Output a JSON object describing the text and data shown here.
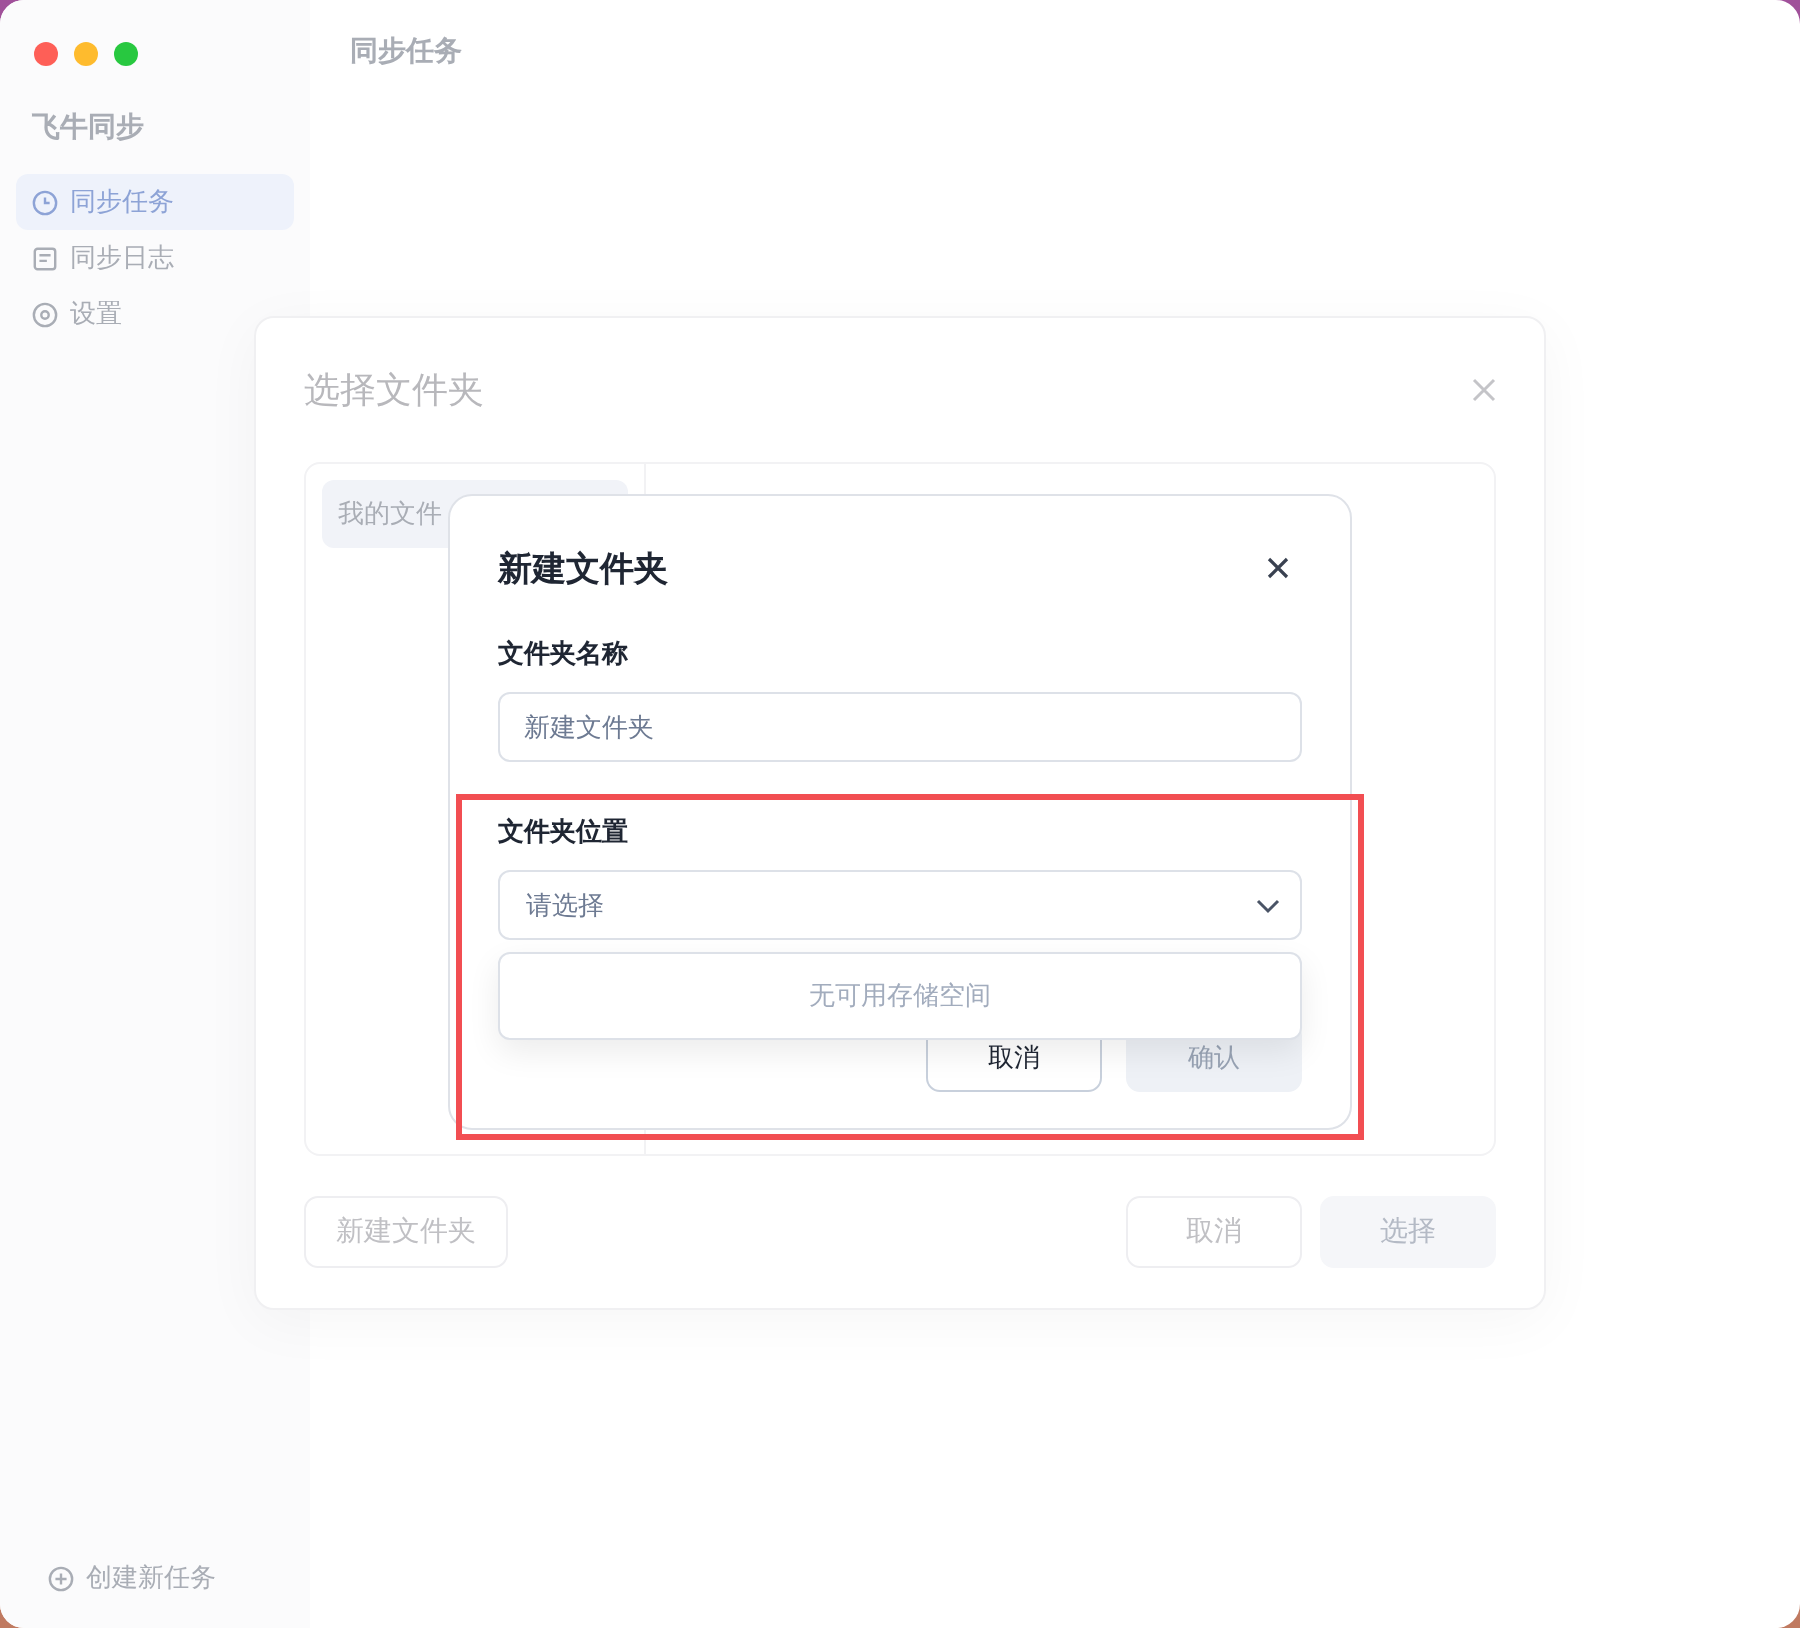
{
  "app": {
    "sidebar": {
      "title": "飞牛同步",
      "items": [
        {
          "label": "同步任务",
          "selected": true
        },
        {
          "label": "同步日志",
          "selected": false
        },
        {
          "label": "设置",
          "selected": false
        }
      ],
      "create_button": "创建新任务"
    },
    "main_title": "同步任务"
  },
  "select_dialog": {
    "title": "选择文件夹",
    "locations": [
      {
        "label": "我的文件",
        "selected": true
      }
    ],
    "new_folder_button": "新建文件夹",
    "buttons": [
      {
        "label": "取消",
        "disabled": false
      },
      {
        "label": "选择",
        "disabled": true
      }
    ]
  },
  "new_folder_dialog": {
    "title": "新建文件夹",
    "name_field": {
      "label": "文件夹名称",
      "value": "新建文件夹"
    },
    "location_field": {
      "label": "文件夹位置",
      "placeholder": "请选择",
      "expanded": true,
      "empty_text": "无可用存储空间"
    },
    "buttons": [
      {
        "label": "取消",
        "disabled": false
      },
      {
        "label": "确认",
        "disabled": true
      }
    ]
  }
}
